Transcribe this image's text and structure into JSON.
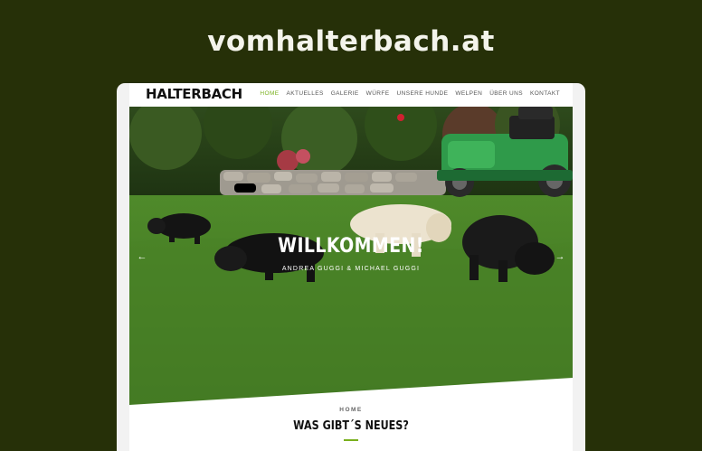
{
  "banner": {
    "domain": "vomhalterbach.at"
  },
  "header": {
    "logo": "HALTERBACH"
  },
  "nav": {
    "items": [
      {
        "label": "HOME",
        "name": "nav-home",
        "active": true
      },
      {
        "label": "AKTUELLES",
        "name": "nav-aktuelles",
        "active": false
      },
      {
        "label": "GALERIE",
        "name": "nav-galerie",
        "active": false
      },
      {
        "label": "WÜRFE",
        "name": "nav-wuerfe",
        "active": false
      },
      {
        "label": "UNSERE HUNDE",
        "name": "nav-unsere-hunde",
        "active": false
      },
      {
        "label": "WELPEN",
        "name": "nav-welpen",
        "active": false
      },
      {
        "label": "ÜBER UNS",
        "name": "nav-ueber-uns",
        "active": false
      },
      {
        "label": "KONTAKT",
        "name": "nav-kontakt",
        "active": false
      }
    ]
  },
  "hero": {
    "title": "WILLKOMMEN!",
    "subtitle": "ANDREA GUGGI & MICHAEL GUGGI",
    "prev_icon": "chevron-left-icon",
    "next_icon": "chevron-right-icon"
  },
  "section": {
    "kicker": "HOME",
    "heading": "WAS GIBT´S NEUES?"
  },
  "colors": {
    "background": "#263008",
    "accent": "#7ab01e",
    "text": "#111111"
  }
}
